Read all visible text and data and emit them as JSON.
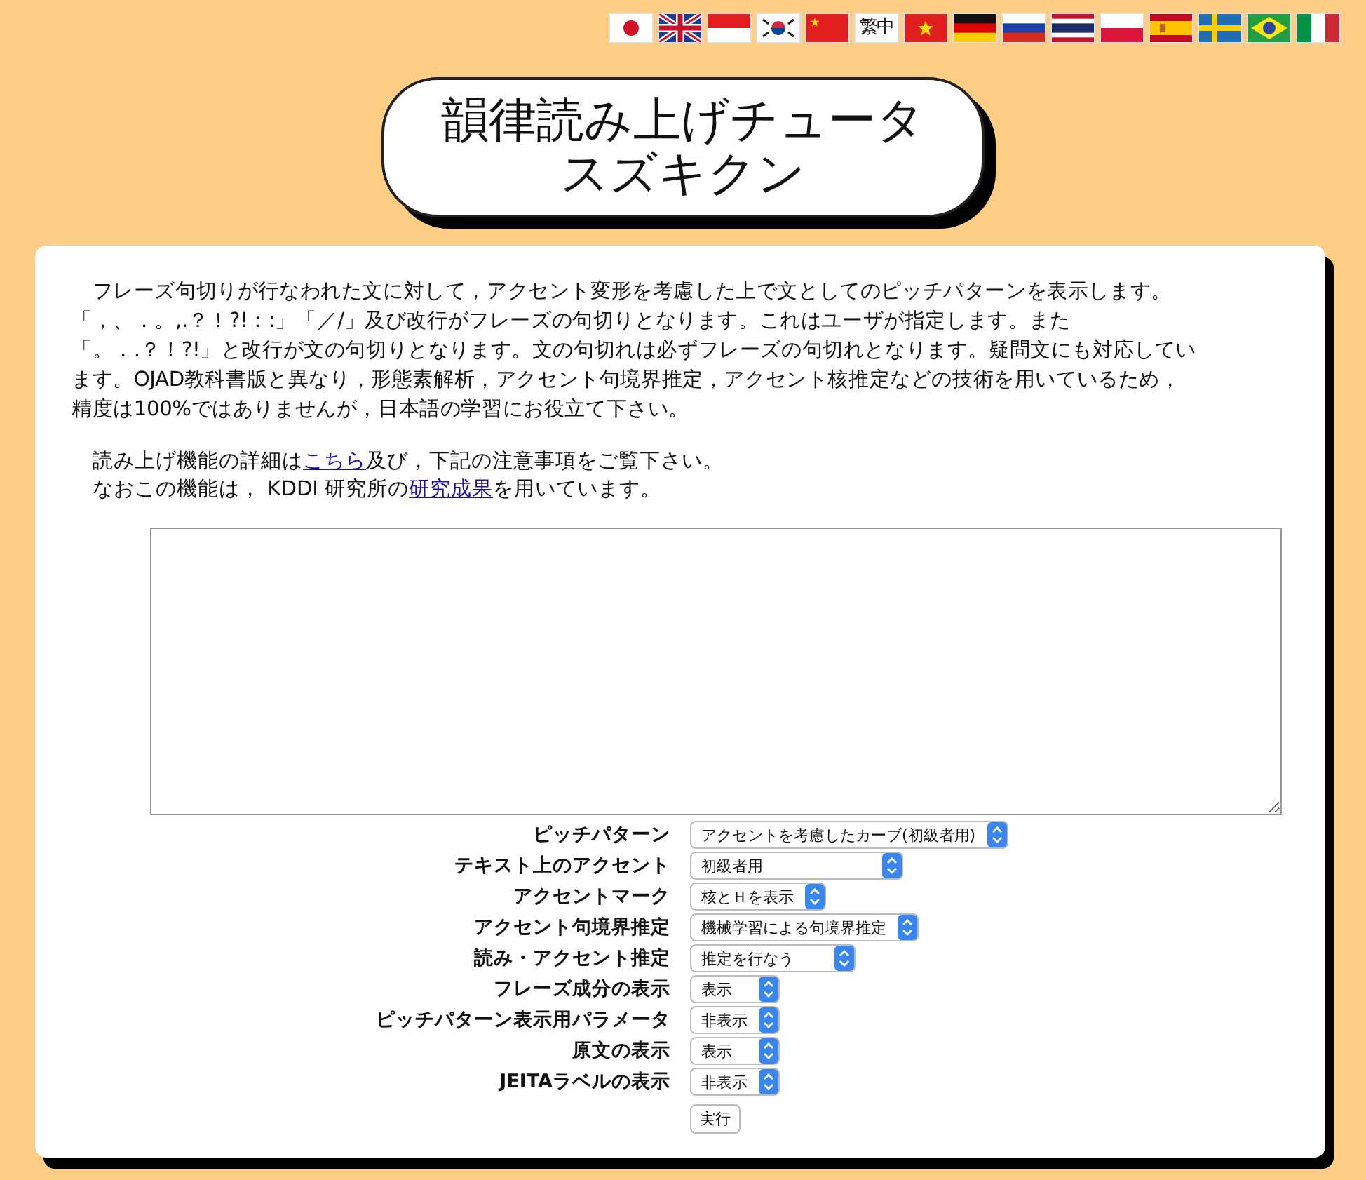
{
  "flags": [
    {
      "kind": "jp"
    },
    {
      "kind": "gb"
    },
    {
      "kind": "id"
    },
    {
      "kind": "kr"
    },
    {
      "kind": "cn"
    },
    {
      "kind": "text",
      "label": "繁中"
    },
    {
      "kind": "vn"
    },
    {
      "kind": "de"
    },
    {
      "kind": "ru"
    },
    {
      "kind": "th"
    },
    {
      "kind": "pl"
    },
    {
      "kind": "es"
    },
    {
      "kind": "se"
    },
    {
      "kind": "br"
    },
    {
      "kind": "it"
    }
  ],
  "title": [
    "韻律読み上げチュータ",
    "スズキクン"
  ],
  "intro_lines": [
    "　フレーズ句切りが行なわれた文に対して，アクセント変形を考慮した上で文としてのピッチパターンを表示します。",
    "「，、．。,.？！?!：:」「／/」及び改行がフレーズの句切りとなります。これはユーザが指定します。また",
    "「。．.？！?!」と改行が文の句切りとなります。文の句切れは必ずフレーズの句切れとなります。疑問文にも対応してい",
    "ます。OJAD教科書版と異なり，形態素解析，アクセント句境界推定，アクセント核推定などの技術を用いているため，",
    "精度は100%ではありませんが，日本語の学習にお役立て下さい。"
  ],
  "notes": [
    {
      "before": "　読み上げ機能の詳細は",
      "link": "こちら",
      "after": "及び，下記の注意事項をご覧下さい。"
    },
    {
      "before": "　なおこの機能は，  KDDI 研究所の",
      "link": "研究成果",
      "after": "を用いています。"
    }
  ],
  "options": [
    {
      "label": "ピッチパターン",
      "value": "アクセントを考慮したカーブ(初級者用)"
    },
    {
      "label": "テキスト上のアクセント",
      "value": "初級者用"
    },
    {
      "label": "アクセントマーク",
      "value": "核とＨを表示"
    },
    {
      "label": "アクセント句境界推定",
      "value": "機械学習による句境界推定"
    },
    {
      "label": "読み・アクセント推定",
      "value": "推定を行なう"
    },
    {
      "label": "フレーズ成分の表示",
      "value": "表示"
    },
    {
      "label": "ピッチパターン表示用パラメータ",
      "value": "非表示"
    },
    {
      "label": "原文の表示",
      "value": "表示"
    },
    {
      "label": "JEITAラベルの表示",
      "value": "非表示"
    }
  ],
  "submit": "実行"
}
